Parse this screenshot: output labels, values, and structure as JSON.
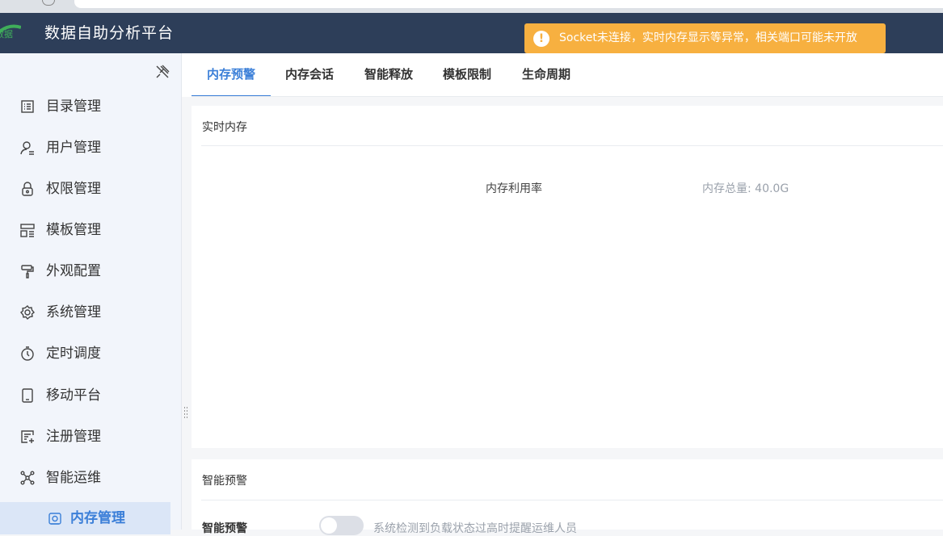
{
  "header": {
    "app_title": "数据自助分析平台",
    "logo_text": "数据"
  },
  "toast": {
    "message": "Socket未连接，实时内存显示等异常，相关端口可能未开放",
    "icon": "warning-icon",
    "color": "#f7b040"
  },
  "sidebar": {
    "items": [
      {
        "label": "目录管理",
        "icon": "catalog-icon"
      },
      {
        "label": "用户管理",
        "icon": "user-icon"
      },
      {
        "label": "权限管理",
        "icon": "lock-icon"
      },
      {
        "label": "模板管理",
        "icon": "template-icon"
      },
      {
        "label": "外观配置",
        "icon": "paint-roller-icon"
      },
      {
        "label": "系统管理",
        "icon": "gear-icon"
      },
      {
        "label": "定时调度",
        "icon": "timer-icon"
      },
      {
        "label": "移动平台",
        "icon": "tablet-icon"
      },
      {
        "label": "注册管理",
        "icon": "register-icon"
      },
      {
        "label": "智能运维",
        "icon": "network-icon"
      }
    ],
    "active_item": {
      "label": "内存管理",
      "icon": "memory-icon"
    }
  },
  "tabs": [
    {
      "label": "内存预警",
      "active": true
    },
    {
      "label": "内存会话",
      "active": false
    },
    {
      "label": "智能释放",
      "active": false
    },
    {
      "label": "模板限制",
      "active": false
    },
    {
      "label": "生命周期",
      "active": false
    }
  ],
  "realtime_card": {
    "title": "实时内存",
    "usage_label": "内存利用率",
    "total_label": "内存总量: 40.0G"
  },
  "warning_card": {
    "title": "智能预警",
    "row_label": "智能预警",
    "row_description": "系统检测到负载状态过高时提醒运维人员",
    "toggle_on": false
  },
  "colors": {
    "header_bg": "#2d3e59",
    "accent": "#3b7fd8",
    "sidebar_bg": "#f2f5fb"
  }
}
